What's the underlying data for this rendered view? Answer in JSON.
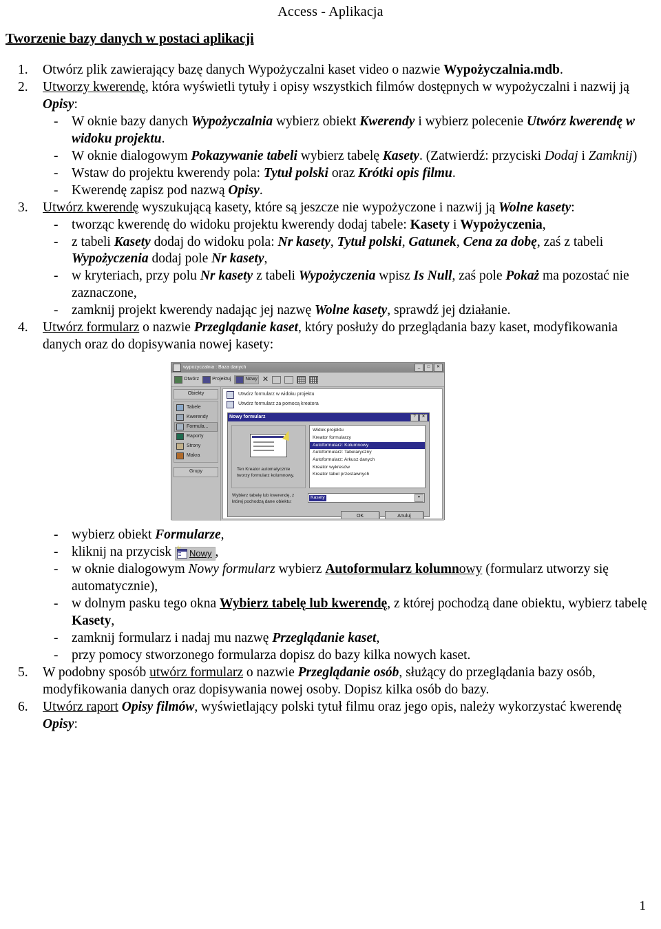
{
  "document": {
    "header_title": "Access - Aplikacja",
    "section_title": "Tworzenie bazy danych w postaci aplikacji",
    "page_number": "1"
  },
  "items": {
    "n1": "1.",
    "n2": "2.",
    "n3": "3.",
    "n4": "4.",
    "n5": "5.",
    "n6": "6.",
    "dash": "-"
  },
  "item1": {
    "text_a": "Otwórz plik zawierający bazę danych Wypożyczalni kaset video o nazwie ",
    "bold_b": "Wypożyczalnia.mdb",
    "text_c": "."
  },
  "item2": {
    "underline_a": "Utworzy kwerendę",
    "text_b": ", która wyświetli tytuły i opisy wszystkich filmów dostępnych w wypożyczalni i nazwij ją ",
    "bolditalic_c": "Opisy",
    "text_d": ":",
    "sub1": {
      "a": "W oknie bazy danych ",
      "bi_b": "Wypożyczalnia",
      "c": " wybierz obiekt ",
      "bi_d": "Kwerendy",
      "e": " i wybierz polecenie ",
      "bi_f": "Utwórz kwerendę w widoku projektu",
      "g": "."
    },
    "sub2": {
      "a": "W oknie dialogowym ",
      "bi_b": "Pokazywanie tabeli",
      "c": " wybierz tabelę ",
      "bi_d": "Kasety",
      "e": ". (Zatwierdź: przyciski ",
      "i_f": "Dodaj",
      "g": " i ",
      "i_h": "Zamknij",
      "i": ")"
    },
    "sub3": {
      "a": "Wstaw do projektu kwerendy pola: ",
      "bi_b": "Tytuł polski",
      "c": " oraz ",
      "bi_d": "Krótki opis filmu",
      "e": "."
    },
    "sub4": {
      "a": "Kwerendę zapisz pod nazwą ",
      "bi_b": "Opisy",
      "c": "."
    }
  },
  "item3": {
    "underline_a": "Utwórz kwerendę",
    "text_b": " wyszukującą kasety, które są jeszcze nie wypożyczone i nazwij ją ",
    "bolditalic_c": "Wolne kasety",
    "text_d": ":",
    "sub1": {
      "a": "tworząc kwerendę do widoku projektu kwerendy dodaj tabele: ",
      "b_b": "Kasety",
      "c": " i ",
      "b_d": "Wypożyczenia",
      "e": ","
    },
    "sub2": {
      "a": "z tabeli ",
      "bi_b": "Kasety",
      "c": " dodaj do widoku pola: ",
      "bi_d": "Nr kasety",
      "e": ", ",
      "bi_f": "Tytuł polski",
      "g": ", ",
      "bi_h": "Gatunek",
      "i": ", ",
      "bi_j": "Cena za dobę",
      "k": ", zaś z tabeli ",
      "bi_l": "Wypożyczenia",
      "m": " dodaj pole ",
      "bi_n": "Nr kasety",
      "o": ","
    },
    "sub3": {
      "a": "w kryteriach, przy polu ",
      "bi_b": "Nr kasety",
      "c": " z tabeli ",
      "bi_d": "Wypożyczenia",
      "e": " wpisz ",
      "bi_f": "Is Null",
      "g": ", zaś pole ",
      "bi_h": "Pokaż",
      "i": " ma pozostać nie zaznaczone,"
    },
    "sub4": {
      "a": "zamknij projekt kwerendy nadając jej nazwę ",
      "bi_b": "Wolne kasety",
      "c": ", sprawdź jej działanie."
    }
  },
  "item4": {
    "underline_a": "Utwórz formularz",
    "text_b": " o nazwie ",
    "bolditalic_c": "Przeglądanie kaset",
    "text_d": ", który posłuży do przeglądania bazy kaset, modyfikowania danych oraz do dopisywania nowej kasety:",
    "sub1": {
      "a": "wybierz obiekt ",
      "bi_b": "Formularze",
      "c": ","
    },
    "sub2": {
      "a": "kliknij na przycisk ",
      "btn_label": "Nowy",
      "c": ","
    },
    "sub3": {
      "a": "w oknie dialogowym ",
      "i_b": "Nowy formularz",
      "c": " wybierz ",
      "bu_d": "Autoformularz kolumn",
      "u_e": "owy",
      "f": " (formularz utworzy się automatycznie),"
    },
    "sub4": {
      "a": "w dolnym pasku tego okna ",
      "bu_b": "Wybierz tabelę lub kwerendę",
      "c": ", z której pochodzą dane obiektu, wybierz tabelę ",
      "b_d": "Kasety",
      "e": ","
    },
    "sub5": {
      "a": "zamknij formularz i nadaj mu nazwę ",
      "bi_b": "Przeglądanie kaset",
      "c": ","
    },
    "sub6": {
      "a": "przy pomocy stworzonego formularza dopisz do bazy kilka nowych kaset."
    }
  },
  "item5": {
    "a": "W podobny sposób ",
    "u_b": "utwórz formularz",
    "c": " o nazwie ",
    "bi_d": "Przeglądanie osób",
    "e": ", służący do przeglądania bazy osób, modyfikowania danych oraz dopisywania nowej osoby. Dopisz kilka osób do bazy."
  },
  "item6": {
    "u_a": "Utwórz raport",
    "b": " ",
    "bi_c": "Opisy filmów",
    "d": ", wyświetlający polski tytuł filmu oraz jego opis, należy wykorzystać kwerendę ",
    "bi_e": "Opisy",
    "f": ":"
  },
  "access_screenshot": {
    "window_title": "wypożyczalnia : Baza danych",
    "window_buttons": {
      "minimize": "_",
      "maximize": "□",
      "close": "✕"
    },
    "toolbar": {
      "open_label": "Otwórz",
      "design_label": "Projektuj",
      "new_label": "Nowy",
      "delete_label": "✕"
    },
    "sidebar": {
      "header": "Obiekty",
      "items": [
        {
          "label": "Tabele"
        },
        {
          "label": "Kwerendy"
        },
        {
          "label": "Formula..."
        },
        {
          "label": "Raporty"
        },
        {
          "label": "Strony"
        },
        {
          "label": "Makra"
        }
      ],
      "footer": "Grupy"
    },
    "shortcuts": [
      "Utwórz formularz w widoku projektu",
      "Utwórz formularz za pomocą kreatora"
    ],
    "dialog": {
      "title": "Nowy formularz",
      "help_button": "?",
      "close_button": "✕",
      "wizard_description": "Ten Kreator automatycznie tworzy formularz kolumnowy.",
      "list_items": [
        "Widok projektu",
        "Kreator formularzy",
        "Autoformularz:  Kolumnowy",
        "Autoformularz:  Tabelaryczny",
        "Autoformularz:  Arkusz danych",
        "Kreator wykresów",
        "Kreator tabel przestawnych"
      ],
      "selected_list_item": "Autoformularz:  Kolumnowy",
      "source_label": "Wybierz tabelę lub kwerendę, z której pochodzą dane obiektu:",
      "source_value": "Kasety",
      "combo_arrow": "▼",
      "ok_label": "OK",
      "cancel_label": "Anuluj"
    }
  }
}
